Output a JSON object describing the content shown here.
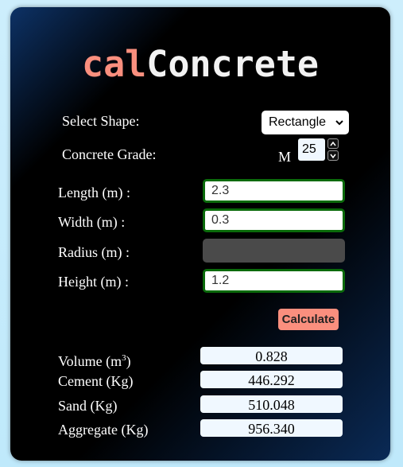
{
  "app": {
    "title_part1": "cal",
    "title_part2": "Concrete",
    "accent_color": "#fa8f7e"
  },
  "form": {
    "shape_label": "Select Shape:",
    "shape_value": "Rectangle",
    "grade_label": "Concrete Grade:",
    "grade_prefix": "M",
    "grade_value": "25"
  },
  "inputs": {
    "length_label": "Length (m) :",
    "length_value": "2.3",
    "width_label": "Width (m) :",
    "width_value": "0.3",
    "radius_label": "Radius (m) :",
    "radius_value": "",
    "height_label": "Height (m) :",
    "height_value": "1.2"
  },
  "actions": {
    "calculate_label": "Calculate"
  },
  "results": {
    "volume_label": "Volume (m",
    "volume_sup": "3",
    "volume_label_end": ")",
    "volume_value": "0.828",
    "cement_label": "Cement (Kg)",
    "cement_value": "446.292",
    "sand_label": "Sand (Kg)",
    "sand_value": "510.048",
    "aggregate_label": "Aggregate (Kg)",
    "aggregate_value": "956.340"
  }
}
